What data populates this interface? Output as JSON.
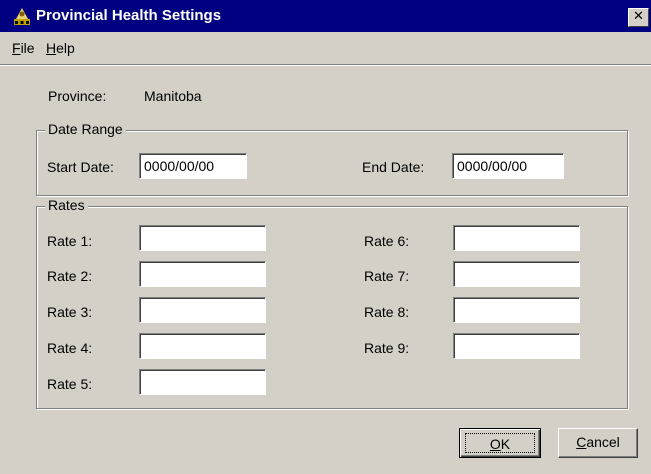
{
  "window": {
    "title": "Provincial Health Settings",
    "close_glyph": "✕",
    "icon": "app-icon"
  },
  "menu": {
    "file": {
      "accel": "F",
      "rest": "ile"
    },
    "help": {
      "accel": "H",
      "rest": "elp"
    }
  },
  "province": {
    "label": "Province:",
    "value": "Manitoba"
  },
  "date_range": {
    "caption": "Date Range",
    "start_label": "Start Date:",
    "start_value": "0000/00/00",
    "end_label": "End Date:",
    "end_value": "0000/00/00"
  },
  "rates": {
    "caption": "Rates",
    "items": [
      {
        "label": "Rate 1:",
        "value": ""
      },
      {
        "label": "Rate 2:",
        "value": ""
      },
      {
        "label": "Rate 3:",
        "value": ""
      },
      {
        "label": "Rate 4:",
        "value": ""
      },
      {
        "label": "Rate 5:",
        "value": ""
      },
      {
        "label": "Rate 6:",
        "value": ""
      },
      {
        "label": "Rate 7:",
        "value": ""
      },
      {
        "label": "Rate 8:",
        "value": ""
      },
      {
        "label": "Rate 9:",
        "value": ""
      }
    ]
  },
  "buttons": {
    "ok": {
      "accel": "O",
      "rest": "K"
    },
    "cancel": {
      "accel": "C",
      "rest": "ancel"
    }
  },
  "colors": {
    "titlebar": "#000080",
    "face": "#d4d0c8"
  }
}
